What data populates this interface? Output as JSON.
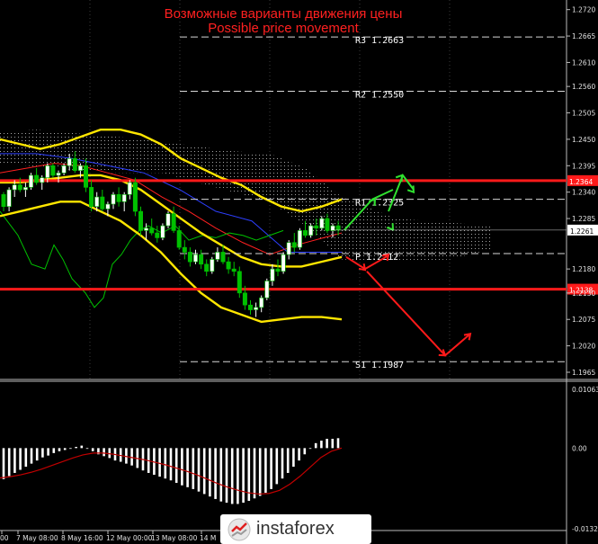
{
  "header": {
    "title_ru": "Возможные варианты движения цены",
    "title_en": "Possible price movement"
  },
  "watermark": {
    "logo_text": "instaforex",
    "logo_icon": "instaforex-logo-icon"
  },
  "colors": {
    "background": "#000000",
    "grid": "#3a3a3a",
    "candle_up": "#ffffff",
    "candle_down": "#00c000",
    "bollinger": "#ffe600",
    "level_line": "#ff1a1a",
    "arrow_up": "#30e030",
    "arrow_down": "#ff1a1a",
    "kumo": "#cfcfcf",
    "tenkan": "#ff2020",
    "kijun": "#2d3fff",
    "chikou": "#00c000",
    "macd_hist": "#ffffff",
    "macd_signal": "#c00000",
    "title": "#ff2020"
  },
  "chart_data": [
    {
      "type": "candlestick",
      "title": "Возможные варианты движения цены / Possible price movement",
      "ylim": [
        1.195,
        1.274
      ],
      "y_ticks": [
        "1.2720",
        "1.2665",
        "1.2610",
        "1.2560",
        "1.2505",
        "1.2450",
        "1.2395",
        "1.2340",
        "1.2285",
        "1.2261",
        "1.2180",
        "1.2130",
        "1.2075",
        "1.2020",
        "1.1965"
      ],
      "x_ticks": [
        "00",
        "7 May 08:00",
        "8 May 16:00",
        "12 May 00:00",
        "13 May 08:00",
        "14 M"
      ],
      "current_price": "1.2261",
      "red_levels": [
        {
          "label": "1.2364",
          "value": 1.2364
        },
        {
          "label": "1.2138",
          "value": 1.2138
        }
      ],
      "pivot_levels": [
        {
          "name": "R3",
          "label": "R3 1.2663",
          "value": 1.2663
        },
        {
          "name": "R2",
          "label": "R2 1.2550",
          "value": 1.255
        },
        {
          "name": "R1",
          "label": "R1 1.2325",
          "value": 1.2325
        },
        {
          "name": "P",
          "label": "P 1.2212",
          "value": 1.2212
        },
        {
          "name": "S1",
          "label": "S1 1.1987",
          "value": 1.1987
        }
      ],
      "candles": [
        [
          1.2335,
          1.234,
          1.23,
          1.231
        ],
        [
          1.231,
          1.235,
          1.23,
          1.2345
        ],
        [
          1.2345,
          1.2365,
          1.233,
          1.2355
        ],
        [
          1.2355,
          1.237,
          1.234,
          1.2345
        ],
        [
          1.2345,
          1.236,
          1.233,
          1.235
        ],
        [
          1.235,
          1.238,
          1.2345,
          1.2375
        ],
        [
          1.2375,
          1.239,
          1.2355,
          1.236
        ],
        [
          1.236,
          1.2375,
          1.2345,
          1.237
        ],
        [
          1.237,
          1.24,
          1.236,
          1.2395
        ],
        [
          1.2395,
          1.24,
          1.237,
          1.2375
        ],
        [
          1.2375,
          1.2385,
          1.236,
          1.238
        ],
        [
          1.238,
          1.24,
          1.2375,
          1.2395
        ],
        [
          1.2395,
          1.242,
          1.2385,
          1.241
        ],
        [
          1.241,
          1.2425,
          1.238,
          1.2385
        ],
        [
          1.2385,
          1.24,
          1.237,
          1.2395
        ],
        [
          1.2395,
          1.241,
          1.234,
          1.235
        ],
        [
          1.235,
          1.2365,
          1.23,
          1.231
        ],
        [
          1.231,
          1.234,
          1.23,
          1.233
        ],
        [
          1.233,
          1.2345,
          1.23,
          1.2305
        ],
        [
          1.2305,
          1.232,
          1.229,
          1.2315
        ],
        [
          1.2315,
          1.234,
          1.2305,
          1.2335
        ],
        [
          1.2335,
          1.235,
          1.231,
          1.232
        ],
        [
          1.232,
          1.234,
          1.23,
          1.2335
        ],
        [
          1.2335,
          1.2365,
          1.2325,
          1.236
        ],
        [
          1.236,
          1.237,
          1.229,
          1.23
        ],
        [
          1.23,
          1.231,
          1.225,
          1.226
        ],
        [
          1.226,
          1.2275,
          1.224,
          1.2265
        ],
        [
          1.2265,
          1.2285,
          1.225,
          1.2255
        ],
        [
          1.2255,
          1.227,
          1.2235,
          1.2245
        ],
        [
          1.2245,
          1.2275,
          1.224,
          1.227
        ],
        [
          1.227,
          1.23,
          1.2265,
          1.2295
        ],
        [
          1.2295,
          1.231,
          1.2255,
          1.226
        ],
        [
          1.226,
          1.227,
          1.222,
          1.2225
        ],
        [
          1.2225,
          1.224,
          1.22,
          1.2215
        ],
        [
          1.2215,
          1.2225,
          1.2185,
          1.2195
        ],
        [
          1.2195,
          1.222,
          1.219,
          1.221
        ],
        [
          1.221,
          1.222,
          1.218,
          1.219
        ],
        [
          1.219,
          1.22,
          1.2165,
          1.2175
        ],
        [
          1.2175,
          1.2205,
          1.217,
          1.22
        ],
        [
          1.22,
          1.2225,
          1.2195,
          1.2215
        ],
        [
          1.2215,
          1.223,
          1.219,
          1.2195
        ],
        [
          1.2195,
          1.2205,
          1.217,
          1.218
        ],
        [
          1.218,
          1.2195,
          1.2165,
          1.2175
        ],
        [
          1.2175,
          1.2185,
          1.212,
          1.213
        ],
        [
          1.213,
          1.2145,
          1.2095,
          1.2105
        ],
        [
          1.2105,
          1.2115,
          1.2085,
          1.2095
        ],
        [
          1.2095,
          1.211,
          1.208,
          1.21
        ],
        [
          1.21,
          1.2125,
          1.209,
          1.212
        ],
        [
          1.212,
          1.216,
          1.2115,
          1.2155
        ],
        [
          1.2155,
          1.219,
          1.2145,
          1.218
        ],
        [
          1.218,
          1.22,
          1.2165,
          1.2175
        ],
        [
          1.2175,
          1.2215,
          1.217,
          1.221
        ],
        [
          1.221,
          1.224,
          1.22,
          1.2235
        ],
        [
          1.2235,
          1.2255,
          1.2215,
          1.2225
        ],
        [
          1.2225,
          1.2265,
          1.222,
          1.226
        ],
        [
          1.226,
          1.228,
          1.2245,
          1.225
        ],
        [
          1.225,
          1.2275,
          1.2245,
          1.227
        ],
        [
          1.227,
          1.2285,
          1.225,
          1.2265
        ],
        [
          1.2265,
          1.229,
          1.226,
          1.2285
        ],
        [
          1.2285,
          1.2295,
          1.2255,
          1.226
        ],
        [
          1.226,
          1.2275,
          1.2245,
          1.227
        ],
        [
          1.227,
          1.228,
          1.225,
          1.2261
        ]
      ],
      "bollinger_upper": [
        1.245,
        1.244,
        1.243,
        1.244,
        1.2455,
        1.247,
        1.247,
        1.246,
        1.244,
        1.241,
        1.239,
        1.237,
        1.2355,
        1.233,
        1.231,
        1.23,
        1.231,
        1.2325
      ],
      "bollinger_middle": [
        1.236,
        1.236,
        1.2365,
        1.237,
        1.2375,
        1.2375,
        1.2365,
        1.2345,
        1.2315,
        1.2285,
        1.2255,
        1.223,
        1.2205,
        1.219,
        1.2185,
        1.2185,
        1.2195,
        1.2205
      ],
      "bollinger_lower": [
        1.229,
        1.23,
        1.231,
        1.232,
        1.232,
        1.23,
        1.228,
        1.225,
        1.2215,
        1.217,
        1.213,
        1.21,
        1.2085,
        1.207,
        1.2075,
        1.208,
        1.208,
        1.2075
      ],
      "forecast_up": [
        [
          1.2261,
          1.2261
        ],
        [
          1.23,
          1.2325
        ],
        [
          1.2375,
          1.2345
        ],
        [
          1.234
        ]
      ],
      "forecast_down": [
        [
          1.2195,
          1.2175,
          1.221
        ],
        [
          1.2175,
          1.201,
          1.2055
        ]
      ]
    },
    {
      "type": "macd",
      "ylim": [
        -0.01328,
        0.01063
      ],
      "y_ticks": [
        "0.01063",
        "0.00",
        "-0.01328"
      ],
      "histogram": [
        -0.005,
        -0.0045,
        -0.004,
        -0.0035,
        -0.003,
        -0.0025,
        -0.002,
        -0.0015,
        -0.0012,
        -0.0008,
        -0.0005,
        -0.0003,
        0.0,
        0.0002,
        0.0004,
        -0.0001,
        -0.0005,
        -0.001,
        -0.0013,
        -0.0016,
        -0.002,
        -0.0022,
        -0.0025,
        -0.0028,
        -0.0032,
        -0.0036,
        -0.004,
        -0.0043,
        -0.0046,
        -0.0049,
        -0.0052,
        -0.0056,
        -0.006,
        -0.0063,
        -0.0066,
        -0.007,
        -0.0074,
        -0.0078,
        -0.0082,
        -0.0086,
        -0.0088,
        -0.009,
        -0.009,
        -0.0088,
        -0.0085,
        -0.0081,
        -0.0077,
        -0.0072,
        -0.0066,
        -0.0058,
        -0.0049,
        -0.004,
        -0.003,
        -0.002,
        -0.001,
        0.0,
        0.0008,
        0.0012,
        0.0015,
        0.0015,
        0.0016
      ],
      "signal": [
        -0.0048,
        -0.0046,
        -0.0043,
        -0.0039,
        -0.0034,
        -0.0028,
        -0.0022,
        -0.0016,
        -0.0011,
        -0.0008,
        -0.0008,
        -0.001,
        -0.0013,
        -0.0016,
        -0.0019,
        -0.0023,
        -0.0027,
        -0.0032,
        -0.0037,
        -0.0043,
        -0.005,
        -0.0057,
        -0.0063,
        -0.0068,
        -0.0072,
        -0.0074,
        -0.0073,
        -0.0068,
        -0.0058,
        -0.0045,
        -0.003,
        -0.0015,
        -0.0005,
        0.0
      ]
    }
  ]
}
